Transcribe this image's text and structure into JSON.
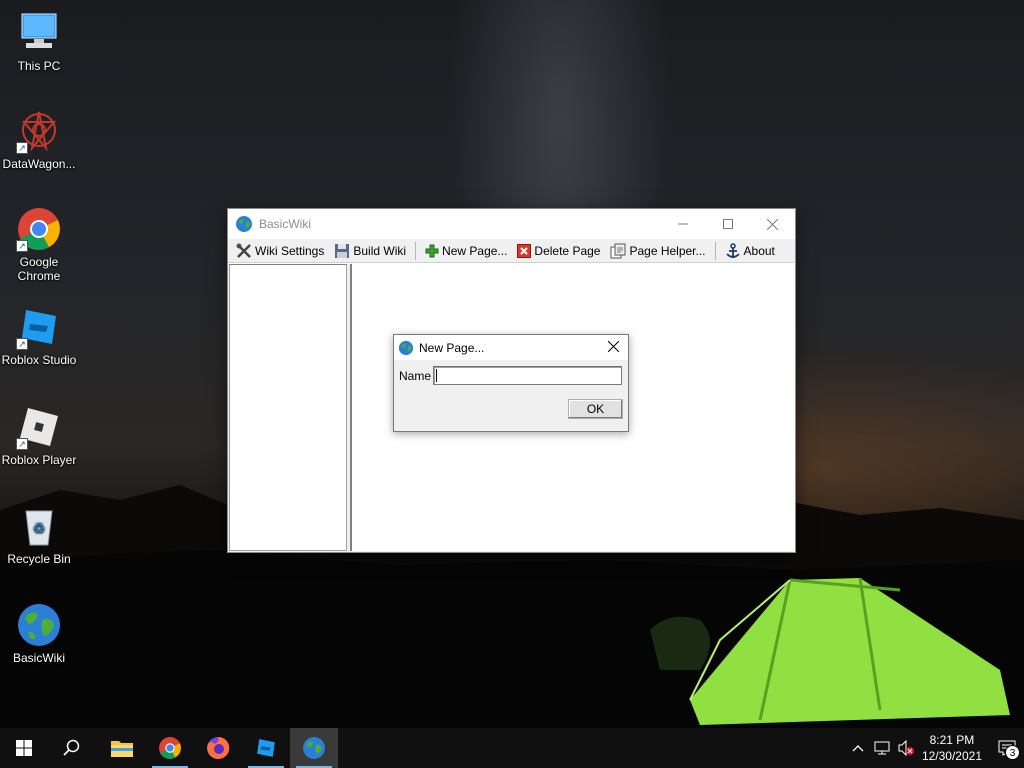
{
  "desktop": {
    "icons": [
      {
        "label": "This PC",
        "icon": "computer-icon"
      },
      {
        "label": "DataWagon...",
        "icon": "datawagon-icon"
      },
      {
        "label": "Google Chrome",
        "icon": "chrome-icon"
      },
      {
        "label": "Roblox Studio",
        "icon": "roblox-studio-icon"
      },
      {
        "label": "Roblox Player",
        "icon": "roblox-player-icon"
      },
      {
        "label": "Recycle Bin",
        "icon": "recycle-bin-icon"
      },
      {
        "label": "BasicWiki",
        "icon": "globe-icon"
      }
    ]
  },
  "window": {
    "title": "BasicWiki",
    "toolbar": {
      "wiki_settings": "Wiki Settings",
      "build_wiki": "Build Wiki",
      "new_page": "New Page...",
      "delete_page": "Delete Page",
      "page_helper": "Page Helper...",
      "about": "About"
    }
  },
  "dialog": {
    "title": "New Page...",
    "name_label": "Name",
    "name_value": "",
    "ok_label": "OK"
  },
  "taskbar": {
    "apps": [
      "start-icon",
      "search-icon",
      "file-explorer-icon",
      "chrome-icon",
      "firefox-icon",
      "roblox-studio-icon",
      "basicwiki-icon"
    ],
    "active_app": "basicwiki-icon",
    "time": "8:21 PM",
    "date": "12/30/2021",
    "notification_count": "3"
  },
  "colors": {
    "accent": "#76b9ed",
    "taskbar": "#101010",
    "tent_green": "#8fe040"
  }
}
